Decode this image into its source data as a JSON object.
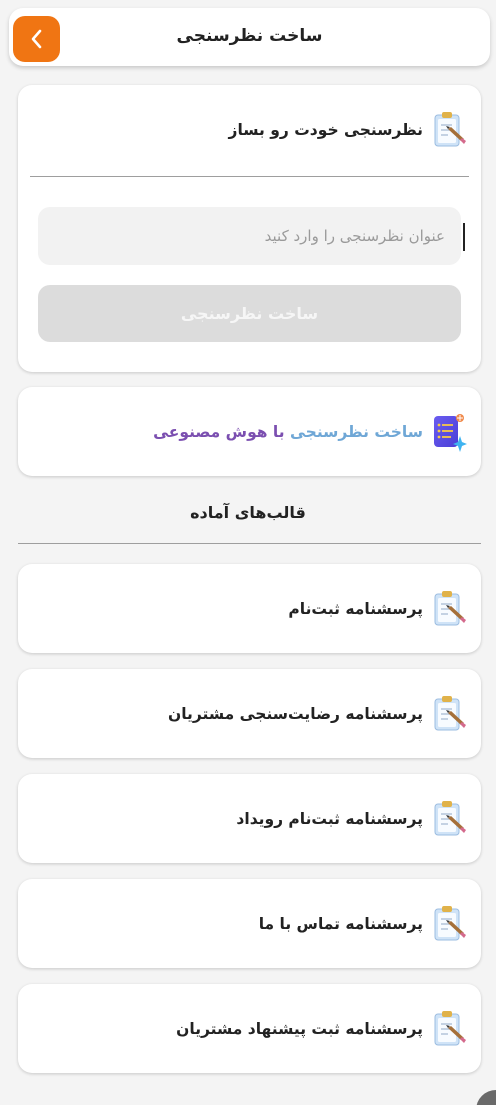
{
  "header": {
    "title": "ساخت نظرسنجی",
    "back_icon": "chevron-left-icon",
    "back_color": "#f07513"
  },
  "creator": {
    "heading": "نظرسنجی خودت رو بساز",
    "icon": "clipboard-icon",
    "input_placeholder": "عنوان نظرسنجی را وارد کنید",
    "input_value": "",
    "create_label": "ساخت نظرسنجی"
  },
  "ai": {
    "label_part1": "ساخت نظرسنجی",
    "label_part2": " با هوش مصنوعی",
    "icon": "ai-document-icon",
    "gradient_from": "#6fa7d6",
    "gradient_to": "#7b4fb0"
  },
  "templates": {
    "section_title": "قالب‌های آماده",
    "items": [
      {
        "label": "پرسشنامه ثبت‌نام",
        "icon": "clipboard-icon"
      },
      {
        "label": "پرسشنامه رضایت‌سنجی مشتریان",
        "icon": "clipboard-icon"
      },
      {
        "label": "پرسشنامه ثبت‌نام رویداد",
        "icon": "clipboard-icon"
      },
      {
        "label": "پرسشنامه تماس با ما",
        "icon": "clipboard-icon"
      },
      {
        "label": "پرسشنامه ثبت پیشنهاد مشتریان",
        "icon": "clipboard-icon"
      }
    ]
  }
}
